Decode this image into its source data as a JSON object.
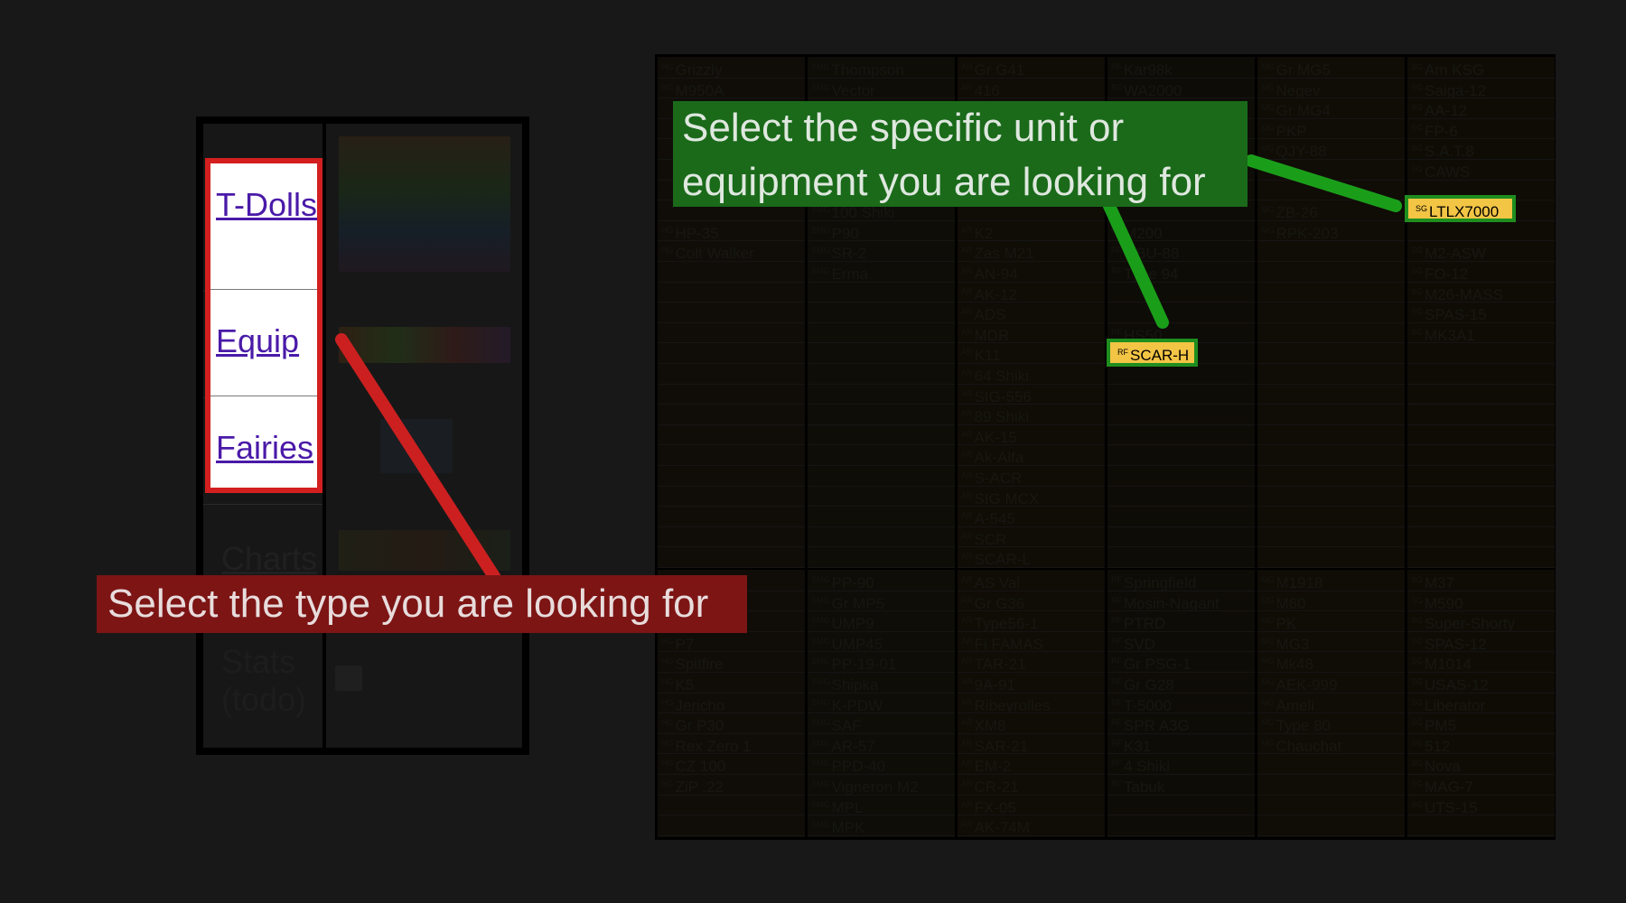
{
  "nav": {
    "links": [
      {
        "label": "T-Dolls"
      },
      {
        "label": "Equip"
      },
      {
        "label": "Fairies"
      },
      {
        "label": "Charts"
      }
    ],
    "stats_label": "Stats (todo)"
  },
  "callouts": {
    "green": "Select the specific unit or equipment you are looking for",
    "red": "Select the type you are looking for"
  },
  "highlights": [
    {
      "type": "SG",
      "name": "LTLX7000"
    },
    {
      "type": "RF",
      "name": "SCAR-H"
    }
  ],
  "table": {
    "top": [
      [
        "Grizzly",
        "M950A",
        "",
        "",
        "",
        "",
        "",
        "",
        "HP-35",
        "Colt Walker"
      ],
      [
        "Thompson",
        "Vector",
        "",
        "",
        "",
        "",
        "",
        "100 Shiki",
        "P90",
        "SR-2",
        "Erma"
      ],
      [
        "Gr G41",
        "416",
        "",
        "",
        "",
        "",
        "",
        "",
        "K2",
        "Zas M21",
        "AN-94",
        "AK-12",
        "ADS",
        "MDR",
        "K11",
        "64 Shiki",
        "SIG-556",
        "89 Shiki",
        "AK-15",
        "Ak-Alfa",
        "S-ACR",
        "SIG MCX",
        "A-545",
        "SCR",
        "SCAR-L"
      ],
      [
        "Kar98k",
        "WA2000",
        "",
        "",
        "",
        "",
        "",
        "",
        "M200",
        "QBU-88",
        "Type 94",
        "",
        "",
        "HS50"
      ],
      [
        "Gr MG5",
        "Negev",
        "Gr MG4",
        "PKP",
        "QJY-88",
        "",
        "",
        "ZB-26",
        "RPK-203"
      ],
      [
        "Am KSG",
        "Saiga-12",
        "AA-12",
        "FP-6",
        "S.A.T.8",
        "CAWS",
        "",
        "",
        "",
        "M2-ASW",
        "FO-12",
        "M26-MASS",
        "SPAS-15",
        "MK3A1"
      ]
    ],
    "bottom": [
      [
        "",
        "",
        "",
        "P7",
        "Spitfire",
        "K5",
        "Jericho",
        "Gr P30",
        "Rex Zero 1",
        "CZ 100",
        "ZiP .22"
      ],
      [
        "PP-90",
        "Gr MP5",
        "UMP9",
        "UMP45",
        "PP-19-01",
        "Shipka",
        "K-PDW",
        "SAF",
        "AR-57",
        "PPD-40",
        "Vigneron M2",
        "MPL",
        "MPK"
      ],
      [
        "AS Val",
        "Gr G36",
        "Type56-1",
        "Fi FAMAS",
        "TAR-21",
        "9A-91",
        "Ribeyrolles",
        "XM8",
        "SAR-21",
        "EM-2",
        "CR-21",
        "FX-05",
        "AK-74M"
      ],
      [
        "Springfield",
        "Mosin-Nagant",
        "PTRD",
        "SVD",
        "Gr PSG-1",
        "Gr G28",
        "T-5000",
        "SPR A3G",
        "K31",
        "4 Shiki",
        "Tabuk"
      ],
      [
        "M1918",
        "M60",
        "PK",
        "MG3",
        "Mk48",
        "AEK-999",
        "Ameli",
        "Type 80",
        "Chauchat"
      ],
      [
        "M37",
        "M590",
        "Super-Shorty",
        "SPAS-12",
        "M1014",
        "USAS-12",
        "Liberator",
        "PM5",
        "512",
        "Nova",
        "MAG-7",
        "UTS-15"
      ]
    ]
  },
  "colors": {
    "green": "#1a6a1a",
    "red": "#7d1515",
    "highlight": "#f3c545"
  }
}
